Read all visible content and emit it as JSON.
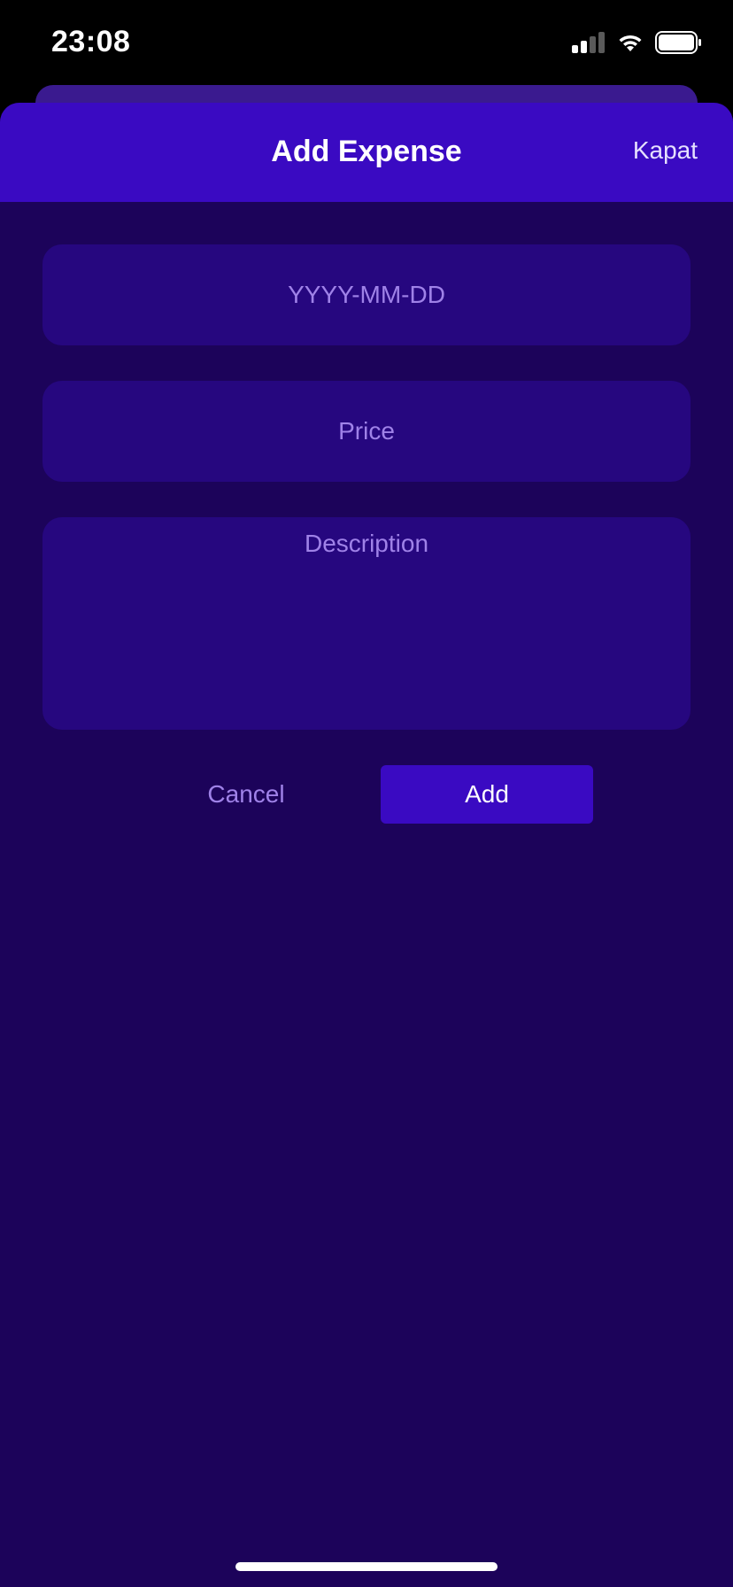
{
  "status_bar": {
    "time": "23:08",
    "icons": [
      "cellular-signal-icon",
      "wifi-icon",
      "battery-icon"
    ]
  },
  "sheet": {
    "title": "Add Expense",
    "close_label": "Kapat"
  },
  "form": {
    "date_placeholder": "YYYY-MM-DD",
    "date_value": "",
    "price_placeholder": "Price",
    "price_value": "",
    "description_placeholder": "Description",
    "description_value": ""
  },
  "actions": {
    "cancel_label": "Cancel",
    "add_label": "Add"
  },
  "colors": {
    "background": "#1c035a",
    "header": "#3a0ac2",
    "field": "#26077f",
    "placeholder": "#9f82e8",
    "accent": "#3a0ac2"
  }
}
